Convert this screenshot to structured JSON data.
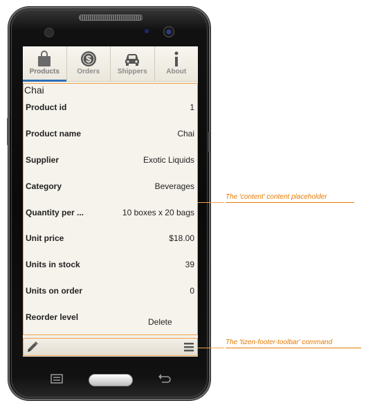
{
  "tabs": [
    {
      "label": "Products",
      "icon": "shopping-bag-icon",
      "active": true
    },
    {
      "label": "Orders",
      "icon": "dollar-coin-icon",
      "active": false
    },
    {
      "label": "Shippers",
      "icon": "car-icon",
      "active": false
    },
    {
      "label": "About",
      "icon": "info-icon",
      "active": false
    }
  ],
  "product": {
    "title": "Chai",
    "fields": [
      {
        "label": "Product id",
        "value": "1"
      },
      {
        "label": "Product name",
        "value": "Chai"
      },
      {
        "label": "Supplier",
        "value": "Exotic Liquids"
      },
      {
        "label": "Category",
        "value": "Beverages"
      },
      {
        "label": "Quantity per ...",
        "value": "10 boxes x 20 bags"
      },
      {
        "label": "Unit price",
        "value": "$18.00"
      },
      {
        "label": "Units in stock",
        "value": "39"
      },
      {
        "label": "Units on order",
        "value": "0"
      },
      {
        "label": "Reorder level",
        "value": ""
      }
    ],
    "delete_label": "Delete"
  },
  "footer": {
    "edit_icon": "pencil-icon",
    "menu_icon": "menu-icon"
  },
  "annotations": {
    "content": "The 'content' content placeholder",
    "footer": "The 'tizen-footer-toolbar' command"
  },
  "colors": {
    "accent": "#2b6fb6",
    "annotation": "#e57a00",
    "frame": "#f0a24a"
  }
}
